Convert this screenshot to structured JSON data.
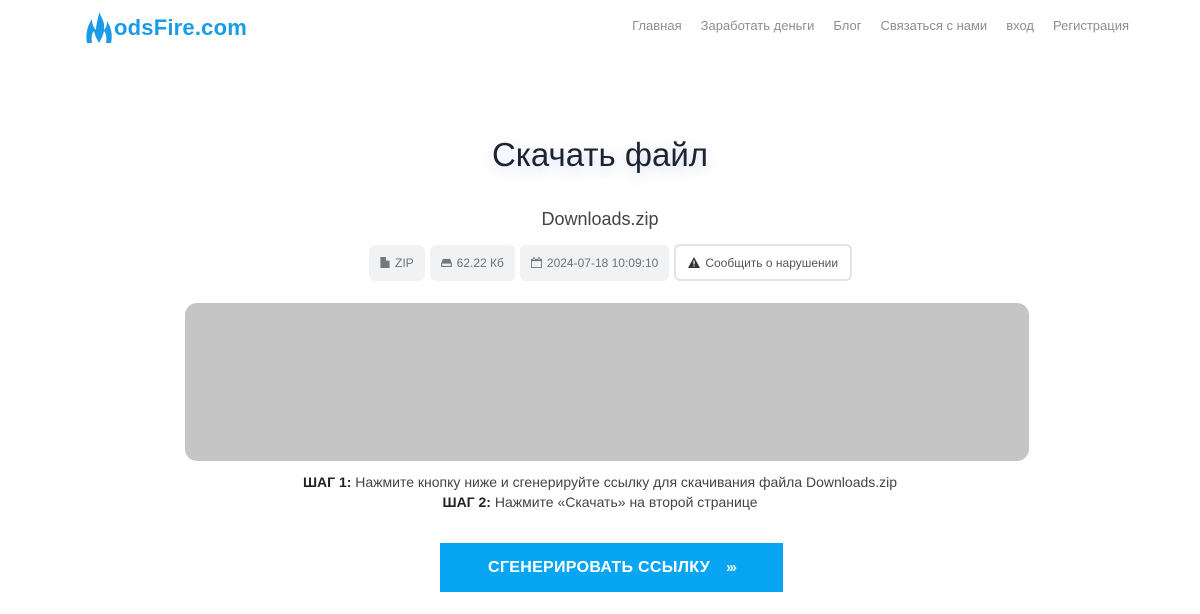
{
  "header": {
    "logo_text": "odsFire.com",
    "nav": [
      {
        "label": "Главная"
      },
      {
        "label": "Заработать деньги"
      },
      {
        "label": "Блог"
      },
      {
        "label": "Связаться с нами"
      },
      {
        "label": "вход"
      },
      {
        "label": "Регистрация"
      }
    ]
  },
  "main": {
    "title": "Скачать файл",
    "filename": "Downloads.zip",
    "badges": {
      "type": {
        "label": "ZIP",
        "icon": "file-icon"
      },
      "size": {
        "label": "62.22 Кб",
        "icon": "hdd-icon"
      },
      "date": {
        "label": "2024-07-18 10:09:10",
        "icon": "calendar-icon"
      },
      "report": {
        "label": "Сообщить о нарушении",
        "icon": "warning-icon"
      }
    },
    "steps": {
      "step1_label": "ШАГ 1:",
      "step1_text": " Нажмите кнопку ниже и сгенерируйте ссылку для скачивания файла Downloads.zip",
      "step2_label": "ШАГ 2:",
      "step2_text": " Нажмите «Скачать» на второй странице"
    },
    "generate_button": {
      "label": "СГЕНЕРИРОВАТЬ ССЫЛКУ",
      "chevrons": "›››"
    }
  },
  "colors": {
    "brand": "#1a9be8",
    "button": "#08a6f2",
    "ad_placeholder": "#c5c5c5"
  }
}
